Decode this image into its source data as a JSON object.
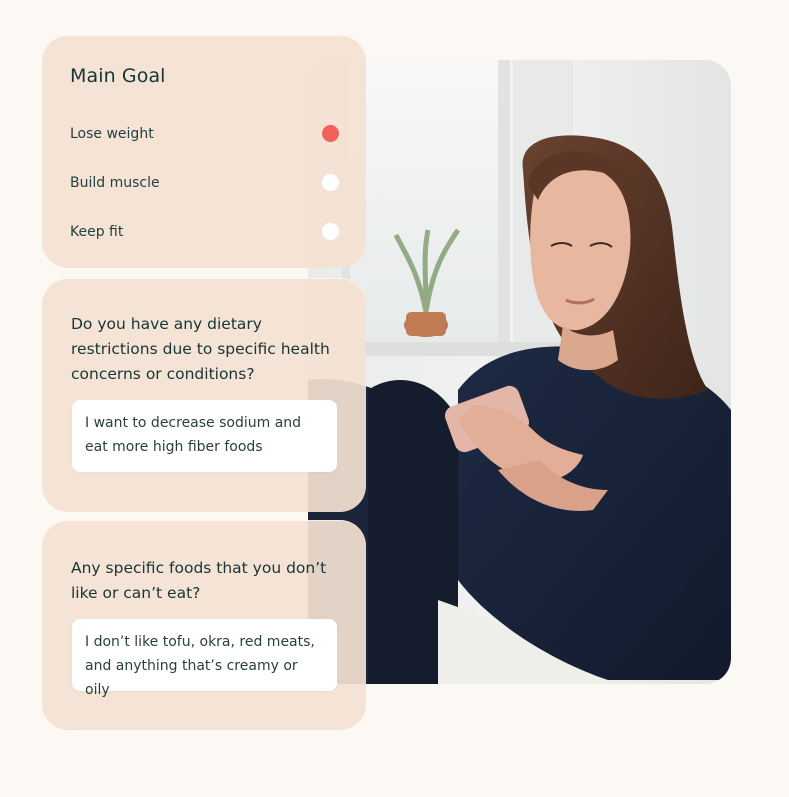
{
  "goal_card": {
    "title": "Main Goal",
    "options": [
      {
        "label": "Lose weight",
        "selected": true
      },
      {
        "label": "Build muscle",
        "selected": false
      },
      {
        "label": "Keep fit",
        "selected": false
      }
    ]
  },
  "diet_card": {
    "question": "Do you have any dietary restrictions due to specific health concerns or conditions?",
    "answer": "I want to decrease sodium and eat more high fiber foods"
  },
  "foods_card": {
    "question": "Any specific foods that you don’t like or can’t eat?",
    "answer": "I don’t like tofu, okra, red meats, and anything that’s creamy or oily"
  },
  "colors": {
    "card_bg": "#f4e2d2",
    "selected_radio": "#f25f5c",
    "text_dark": "#173535",
    "page_bg": "#fcf9f5"
  },
  "photo": {
    "subject": "woman-using-smartphone"
  }
}
